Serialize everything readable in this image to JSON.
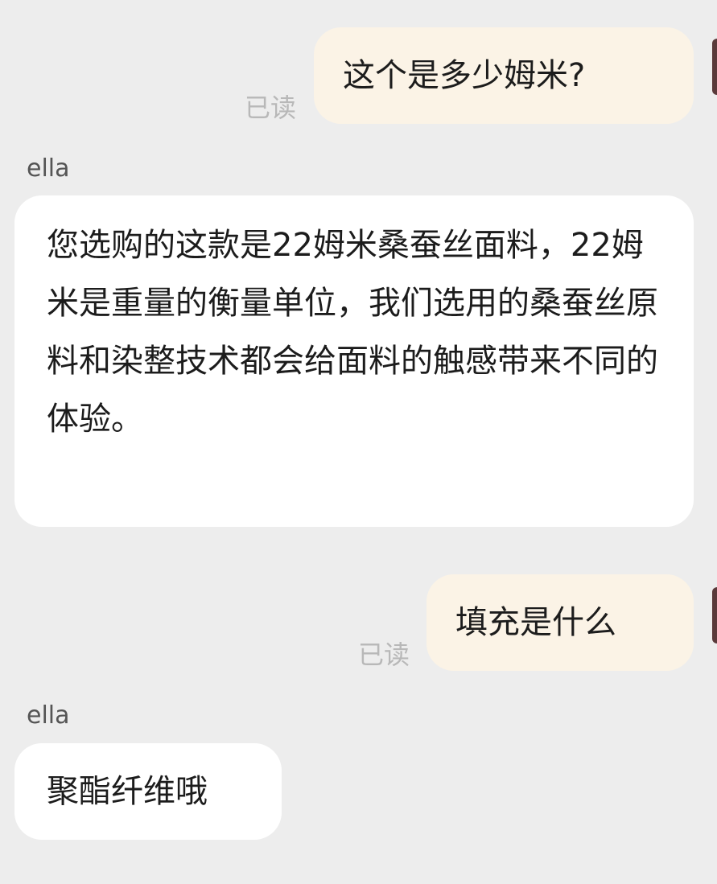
{
  "chat": {
    "messages": [
      {
        "direction": "outgoing",
        "text": "这个是多少姆米?",
        "status": "已读"
      },
      {
        "direction": "incoming",
        "sender": "ella",
        "text": "您选购的这款是22姆米桑蚕丝面料，22姆米是重量的衡量单位，我们选用的桑蚕丝原料和染整技术都会给面料的触感带来不同的体验。"
      },
      {
        "direction": "outgoing",
        "text": "填充是什么",
        "status": "已读"
      },
      {
        "direction": "incoming",
        "sender": "ella",
        "text": "聚酯纤维哦"
      }
    ]
  },
  "colors": {
    "background": "#ededed",
    "outgoing_bubble": "#fbf3e6",
    "incoming_bubble": "#ffffff",
    "read_status": "#b8b8b8"
  }
}
